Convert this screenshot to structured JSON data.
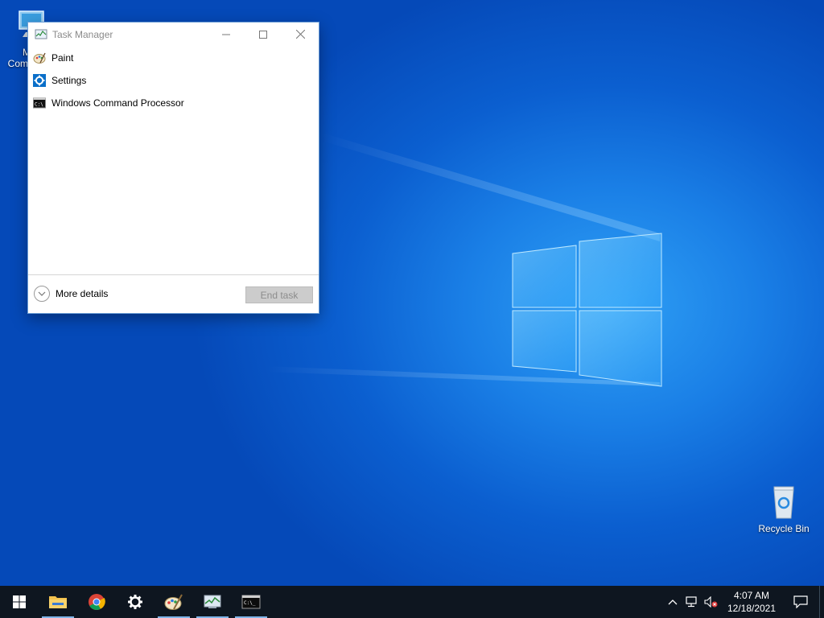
{
  "desktop": {
    "icons": [
      {
        "label": "My Computer",
        "icon": "computer-icon"
      },
      {
        "label": "Recycle Bin",
        "icon": "recycle-bin-icon"
      }
    ]
  },
  "window": {
    "title": "Task Manager",
    "icon": "task-manager-icon",
    "apps": [
      {
        "label": "Paint",
        "icon": "paint-icon"
      },
      {
        "label": "Settings",
        "icon": "settings-gear-icon"
      },
      {
        "label": "Windows Command Processor",
        "icon": "cmd-icon"
      }
    ],
    "more_details": "More details",
    "end_task": "End task"
  },
  "taskbar": {
    "items": [
      {
        "name": "start",
        "icon": "windows-logo-icon"
      },
      {
        "name": "file-explorer",
        "icon": "folder-icon"
      },
      {
        "name": "chrome",
        "icon": "chrome-icon"
      },
      {
        "name": "settings",
        "icon": "gear-icon"
      },
      {
        "name": "paint",
        "icon": "paint-icon"
      },
      {
        "name": "task-manager",
        "icon": "task-manager-icon"
      },
      {
        "name": "cmd",
        "icon": "cmd-icon"
      }
    ],
    "clock": {
      "time": "4:07 AM",
      "date": "12/18/2021"
    }
  },
  "colors": {
    "desktop_bg": "#0b5fd0",
    "taskbar_bg": "#0e1620",
    "accent": "#0078d7"
  }
}
